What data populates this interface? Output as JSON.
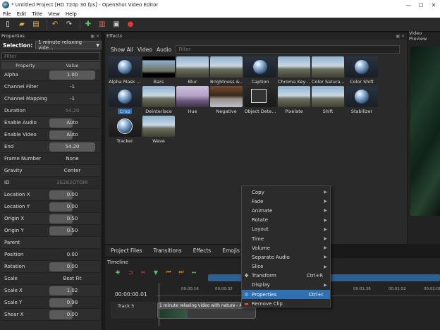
{
  "window": {
    "title": "* Untitled Project [HD 720p 30 fps] - OpenShot Video Editor"
  },
  "menubar": [
    "File",
    "Edit",
    "Title",
    "View",
    "Help"
  ],
  "properties": {
    "header": "Properties",
    "selection_label": "Selection:",
    "selection_value": "1 minute relaxing vide...",
    "filter_placeholder": "Filter",
    "col_property": "Property",
    "col_value": "Value",
    "rows": [
      {
        "name": "Alpha",
        "value": "1.00",
        "fill": 1.0
      },
      {
        "name": "Channel Filter",
        "value": "-1",
        "fill": 0.0
      },
      {
        "name": "Channel Mapping",
        "value": "-1",
        "fill": 0.0
      },
      {
        "name": "Duration",
        "value": "54.20",
        "dim": true
      },
      {
        "name": "Enable Audio",
        "value": "Auto",
        "fill": 0.5
      },
      {
        "name": "Enable Video",
        "value": "Auto",
        "fill": 0.5
      },
      {
        "name": "End",
        "value": "54.20",
        "fill": 1.0
      },
      {
        "name": "Frame Number",
        "value": "None"
      },
      {
        "name": "Gravity",
        "value": "Center"
      },
      {
        "name": "ID",
        "value": "3E282OTOIR",
        "dim": true
      },
      {
        "name": "Location X",
        "value": "0.00",
        "fill": 0.5
      },
      {
        "name": "Location Y",
        "value": "0.00",
        "fill": 0.5
      },
      {
        "name": "Origin X",
        "value": "0.50",
        "fill": 0.5
      },
      {
        "name": "Origin Y",
        "value": "0.50",
        "fill": 0.5
      },
      {
        "name": "Parent",
        "value": ""
      },
      {
        "name": "Position",
        "value": "0.00"
      },
      {
        "name": "Rotation",
        "value": "0.00",
        "fill": 0.5
      },
      {
        "name": "Scale",
        "value": "Best Fit"
      },
      {
        "name": "Scale X",
        "value": "1.02",
        "fill": 0.5
      },
      {
        "name": "Scale Y",
        "value": "0.98",
        "fill": 0.5
      },
      {
        "name": "Shear X",
        "value": "0.00",
        "fill": 0.5
      }
    ]
  },
  "effects": {
    "header": "Effects",
    "tabs": [
      "Show All",
      "Video",
      "Audio"
    ],
    "filter_placeholder": "Filter",
    "items": [
      {
        "label": "Alpha Mask ...",
        "style": "orb"
      },
      {
        "label": "Bars",
        "style": "bars"
      },
      {
        "label": "Blur",
        "style": "sky"
      },
      {
        "label": "Brightness &...",
        "style": "sky"
      },
      {
        "label": "Caption",
        "style": "orb"
      },
      {
        "label": "Chroma Key ...",
        "style": "sky"
      },
      {
        "label": "Color Satura...",
        "style": "sky"
      },
      {
        "label": "Color Shift",
        "style": "orb"
      },
      {
        "label": "Crop",
        "style": "orb",
        "selected": true
      },
      {
        "label": "Deinterlace",
        "style": "sky"
      },
      {
        "label": "Hue",
        "style": "hue"
      },
      {
        "label": "Negative",
        "style": "neg"
      },
      {
        "label": "Object Dete...",
        "style": "obj"
      },
      {
        "label": "Pixelate",
        "style": "sky"
      },
      {
        "label": "Shift",
        "style": "sky"
      },
      {
        "label": "Stabilizer",
        "style": "orb"
      },
      {
        "label": "Tracker",
        "style": "tracker"
      },
      {
        "label": "Wave",
        "style": "sky"
      }
    ]
  },
  "preview": {
    "header": "Video Preview"
  },
  "bottom_tabs": [
    "Project Files",
    "Transitions",
    "Effects",
    "Emojis"
  ],
  "timeline": {
    "header": "Timeline",
    "time": "00:00:00.01",
    "ticks": [
      "00:00:16",
      "00:00:32",
      "00:01:36",
      "00:01:52",
      "00:02:08"
    ],
    "track_label": "Track 5",
    "clip_title": "1 minute relaxing video with nature - A s..."
  },
  "context_menu": [
    {
      "label": "Copy",
      "submenu": true
    },
    {
      "label": "Fade",
      "submenu": true
    },
    {
      "label": "Animate",
      "submenu": true
    },
    {
      "label": "Rotate",
      "submenu": true
    },
    {
      "label": "Layout",
      "submenu": true
    },
    {
      "label": "Time",
      "submenu": true
    },
    {
      "label": "Volume",
      "submenu": true
    },
    {
      "label": "Separate Audio",
      "submenu": true
    },
    {
      "label": "Slice",
      "submenu": true
    },
    {
      "label": "Transform",
      "shortcut": "Ctrl+R",
      "icon": "transform-icon"
    },
    {
      "label": "Display",
      "submenu": true
    },
    {
      "label": "Properties",
      "shortcut": "Ctrl+I",
      "icon": "gear-icon",
      "active": true
    },
    {
      "label": "Remove Clip",
      "icon": "remove-icon"
    }
  ],
  "colors": {
    "accent": "#2f6fb3",
    "panel": "#2a2a2a",
    "background": "#191919"
  }
}
